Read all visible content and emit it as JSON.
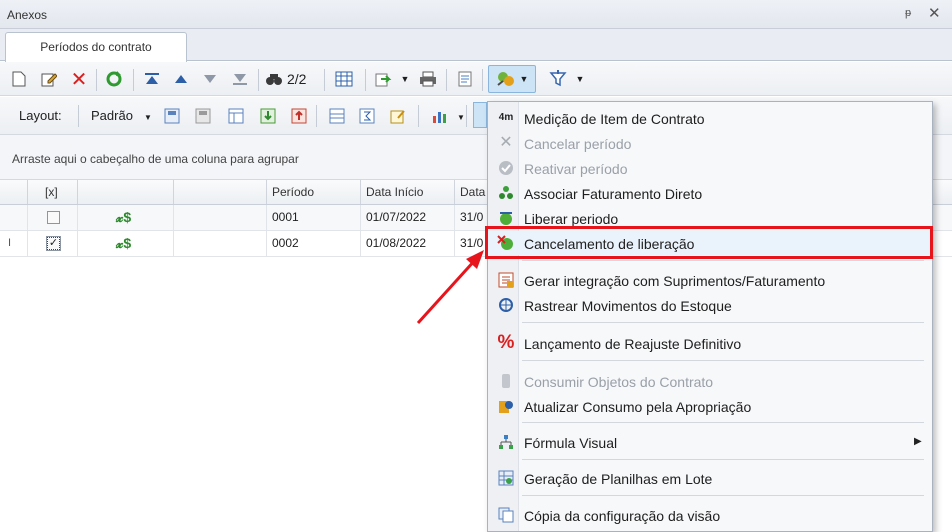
{
  "window": {
    "title": "Anexos",
    "pin_label": "ᵽ",
    "close_label": "✕"
  },
  "tabs": [
    {
      "label": "Períodos do contrato"
    }
  ],
  "toolbar1": {
    "record_counter": "2/2"
  },
  "toolbar2": {
    "layout_label": "Layout:",
    "layout_value": "Padrão"
  },
  "group_panel": {
    "hint": "Arraste aqui o cabeçalho de uma coluna para agrupar"
  },
  "grid": {
    "columns": [
      "[x]",
      "",
      "",
      "Período",
      "Data Início",
      "Data"
    ],
    "rows": [
      {
        "periodo": "0001",
        "data_inicio": "01/07/2022",
        "data_fim": "31/0",
        "checked": false
      },
      {
        "periodo": "0002",
        "data_inicio": "01/08/2022",
        "data_fim": "31/0",
        "checked": true
      }
    ]
  },
  "context_menu": {
    "items": [
      {
        "label": "Medição de Item de Contrato",
        "icon": "measure-icon",
        "disabled": false
      },
      {
        "label": "Cancelar período",
        "icon": "cancel-x-icon",
        "disabled": true
      },
      {
        "label": "Reativar período",
        "icon": "check-circle-icon",
        "disabled": true
      },
      {
        "label": "Associar Faturamento Direto",
        "icon": "people-icon",
        "disabled": false
      },
      {
        "label": "Liberar periodo",
        "icon": "release-icon",
        "disabled": false
      },
      {
        "label": "Cancelamento de liberação",
        "icon": "cancel-release-icon",
        "disabled": false
      },
      {
        "label": "Gerar integração com Suprimentos/Faturamento",
        "icon": "integration-icon",
        "disabled": false
      },
      {
        "label": "Rastrear Movimentos do Estoque",
        "icon": "track-icon",
        "disabled": false
      },
      {
        "label": "Lançamento de Reajuste Definitivo",
        "icon": "percent-icon",
        "disabled": false
      },
      {
        "label": "Consumir Objetos do Contrato",
        "icon": "consume-icon",
        "disabled": true
      },
      {
        "label": "Atualizar Consumo pela Apropriação",
        "icon": "update-icon",
        "disabled": false
      },
      {
        "label": "Fórmula Visual",
        "icon": "formula-icon",
        "disabled": false,
        "has_submenu": true
      },
      {
        "label": "Geração de Planilhas em Lote",
        "icon": "sheets-icon",
        "disabled": false
      },
      {
        "label": "Cópia da configuração da visão",
        "icon": "copy-icon",
        "disabled": false
      }
    ]
  },
  "colors": {
    "highlight": "#e8141c",
    "accent": "#cde4f7"
  }
}
